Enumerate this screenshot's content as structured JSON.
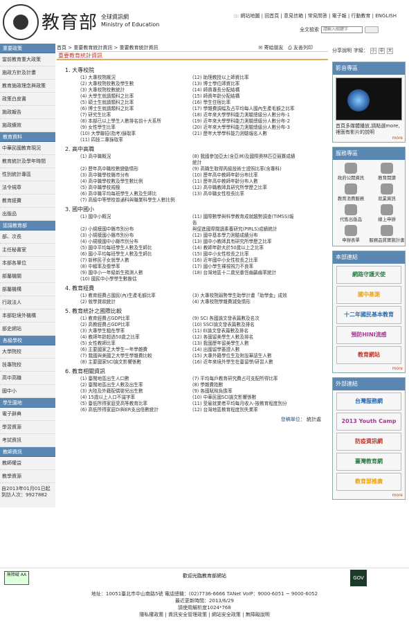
{
  "header": {
    "title_cn": "教育部",
    "subtitle_cn": "全球資訊網",
    "subtitle_en": "Ministry of Education",
    "links": "::: 網站地圖 | 回首頁 | 意見信箱 | 常見問答 | 電子報 | 行動教育 | ENGLISH",
    "search_label": "全文檢索",
    "search_placeholder": "請輸入關鍵字",
    "search_button": "GO"
  },
  "left_nav": [
    {
      "cat": "重要政策",
      "items": [
        "當前教育重大政策",
        "施政方針及計畫",
        "教育施政理念與政策",
        "政策白皮書",
        "施政報告",
        "施政績效"
      ]
    },
    {
      "cat": "教育資料",
      "items": [
        "中華民國教育現況",
        "教育統計及學年時間",
        "性別統計專區",
        "法令規章",
        "教育經費",
        "出版品"
      ]
    },
    {
      "cat": "認識教育部",
      "items": [
        "部、次長",
        "主任秘書室",
        "本部各單位",
        "部屬機關",
        "部屬機構",
        "行政法人",
        "本部駐境外機構",
        "部史網站"
      ]
    },
    {
      "cat": "各級學校",
      "items": [
        "大學院校",
        "技專院校",
        "高中高職",
        "國中小"
      ]
    },
    {
      "cat": "學生園地",
      "items": [
        "電子辭典",
        "學習資源",
        "考試資訊"
      ]
    },
    {
      "cat": "教師資訊",
      "items": [
        "教師權益",
        "教學資源"
      ]
    }
  ],
  "counter": "自2013年01月01日起到訪人次：9927882",
  "breadcrumb": "首頁 > 重要教育統計資訊 > 重要教育統計資訊",
  "tools": {
    "mail": "寄給朋友",
    "print": "友善列印"
  },
  "page_title": "重要教育統計資訊",
  "sections": [
    {
      "title": "1.  大專校院",
      "items": [
        "(1) 大專校院概況",
        "(12) 助理教授以上師資比率",
        "(2) 大專校院校數及學生數",
        "(13) 博士學位師資比率",
        "(3) 大專校院校數統計",
        "(14) 師資專長分配結構",
        "(4) 大學生就讀類科之比率",
        "(15) 師資年齡分配結構",
        "(5) 碩士生就讀類科之比率",
        "(16) 學生住宿比率",
        "(6) 博士生就讀類科之比率",
        "(17) 學雜費調幅及占平均每人國內生產毛額之比率",
        "(7) 研究生比率",
        "(18) 近年來大學學科能力測驗總級分人數分布-1",
        "(8) 本部已以上學生人數排名前十大系所",
        "(19) 近年來大學學科能力測驗總級分人數分布-2",
        "(9) 女性學生比率",
        "(20) 近年來大學學科能力測驗總級分人數分布-3",
        "(10) 大學聯招(指考)錄取率",
        "(21) 歷年大學學科能力測驗報名人數",
        "(11) 四技二專錄取率",
        ""
      ]
    },
    {
      "title": "2.  高中高職",
      "items": [
        "(1) 高中職概況",
        "(8) 我國參加亞太(含亞洲)及國際奧林匹亞競賽成績統計",
        "(2) 歷年高中職校數變動情形",
        "(9) 高職生取得丙級技術士證照比率(含專科)",
        "(3) 高中職學校縣市分布",
        "(10) 歷年高中教師年齡分布比率",
        "(4) 高中職學校數及學生數比例",
        "(11) 歷年高中教師年齡分布人數",
        "(5) 高中職學校規模",
        "(12) 高中職教師具研究所學歷之比率",
        "(6) 高中職平均每班學生人數及生師比",
        "(13) 高中職女性校長比率",
        "(7) 高級中等學校普通科與職業科學生人數比例",
        ""
      ]
    },
    {
      "title": "3.  國中國小",
      "items": [
        "(1) 國中小概況",
        "(11) 國際數學與科學教育成就趨勢調查(TIMSS)報告",
        "(2) 小規模國中縣市別分布",
        "與促進國際閱讀素養研究(PIRLS)成績統計",
        "(3) 小規模國小縣市別分布",
        "(12) 國中基本學力測驗成績分布",
        "(4) 小規模國中小縣市別分布",
        "(13) 國中小教師具有研究所學歷之比率",
        "(5) 國中平均每班學生人數及生師比",
        "(14) 教師年齡大於50歲以上之比率",
        "(6) 國小平均每班學生人數及生師比",
        "(15) 國中小女性校長之比率",
        "(7) 新移民子女就學人數",
        "(16) 近年國中小女性校長之比率",
        "(8) 中輟率及復學率",
        "(17) 國小學生裸視視力不良率",
        "(9) 國中小一年級新生預測人數",
        "(18) 台灣地區十二歲兒童恆齒齲齒率統計",
        "(10) 國民中小學學生數推估",
        ""
      ]
    },
    {
      "title": "4.  教育經費",
      "items": [
        "(1) 教育經費占國民(內)生產毛額比率",
        "(3) 大專校院弱勢學生助學計畫「助學金」成效",
        "(2) 就學貸款統計",
        "(4) 大專校院學雜費減免情形"
      ]
    },
    {
      "title": "5.  教育統計之國際比較",
      "items": [
        "(1) 教育經費占GDP比率",
        "(9) SCI 各國論文發表篇數及名次",
        "(2) 高教經費占GDP比率",
        "(10) SSCI論文發表篇數及排名",
        "(3) 大專學生粗在學率",
        "(11) EI論文發表篇數及排名",
        "(4) 教師年齡超過50歲之比率",
        "(12) 各國留美學生人數及排名",
        "(5) 女性教師比率",
        "(13) 我國歷年留美學生人數",
        "(6) 主要國家之大學生一年學雜費",
        "(14) 出國留學簽證人數",
        "(7) 我國與美國之大學生學雜費比較",
        "(15) 大專外籍學位生及附設華語生人數",
        "(8) 主要國家SCI論文影響係數",
        "(16) 近年來境外學生在臺留學/研習人數"
      ]
    },
    {
      "title": "6.  教育相關資訊",
      "items": [
        "(1) 臺閩地區出生人口數",
        "(7) 平均每戶教育研究費占可支配所得比率",
        "(2) 臺閩地區出生人數及出生率",
        "(8) 學雜費指數",
        "(3) 大陸及外籍配偶嬰兒出生數",
        "(9) 各國賦稅負擔率",
        "(4) 15歲以上人口不識字率",
        "(10) 中華民國SCI論文影響係數",
        "(5) 臺低所得家庭受高等教育比率",
        "(11) 受雇就業者平均每月收入-按教育程度別分",
        "(6) 高低所得家庭DI與ER支出倍數統計",
        "(12) 台灣地區教育程度別失業率"
      ]
    }
  ],
  "unit": {
    "label": "發稿單位：",
    "value": "統計處"
  },
  "right": {
    "share": "分享說明",
    "fontsize": "字級：",
    "sizes": [
      "小",
      "中",
      "大"
    ],
    "media_title": "影音專區",
    "media_caption": "首頁多媒體播放,請點選more,裡面有影片的説明",
    "more": "more",
    "service_title": "服務專區",
    "services": [
      "政府公開資訊",
      "教育閱讀",
      "教育消費服務",
      "就業資訊",
      "代售出版品",
      "線上申辦",
      "申辦表單",
      "服務品質實施計畫"
    ],
    "links_title": "本部連結",
    "banners": [
      "網路守護天使",
      "國中基測",
      "十二年國民基本教育",
      "預防HINI流感",
      "教育網站"
    ],
    "ext_title": "外部連結",
    "ext_banners": [
      "台灣服務網",
      "2013 Youth Camp",
      "防疫資訊網",
      "臺灣教育網",
      "教育部推廣"
    ]
  },
  "footer": {
    "badge": "無障礙 AA",
    "welcome": "歡迎光臨教育部網站",
    "address": "地址：10051臺北市中山南路5號",
    "phone": "電話總機：(02)7736-6666 TANet VoIP：9000-6051 ~ 9000-6052",
    "updated": "最近更新時間：2013/6/29",
    "resolution": "請使用解析度1024*768",
    "links": "隱私權政策 | 資訊安全管理政策 | 網站安全政策 | 無障礙說明",
    "gov": "GOV"
  }
}
